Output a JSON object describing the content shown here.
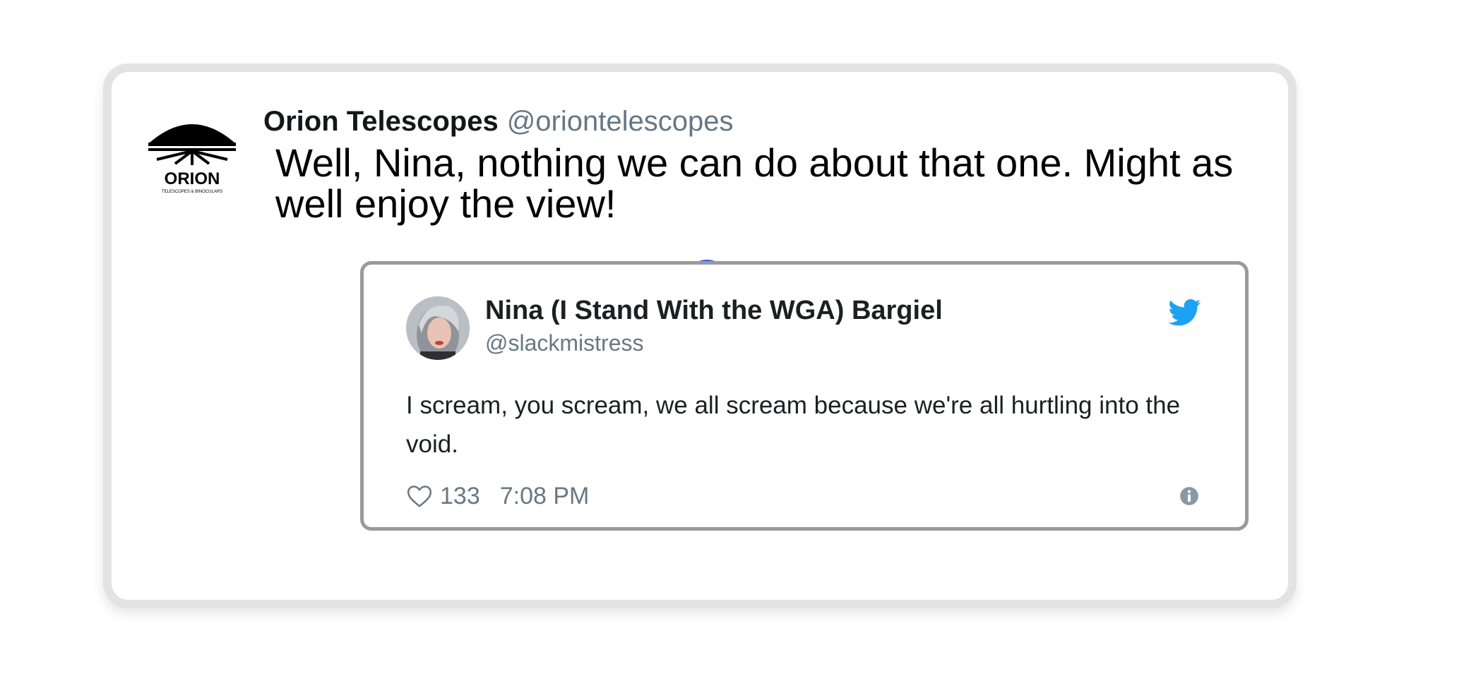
{
  "tweet": {
    "author_name": "Orion Telescopes",
    "author_handle": "@oriontelescopes",
    "text": "Well, Nina, nothing we can do about that one. Might as well enjoy the view!",
    "logo": {
      "icon": "orion-logo-icon",
      "wordmark": "ORION",
      "tagline": "TELESCOPES & BINOCULARS"
    }
  },
  "quoted": {
    "author_name": "Nina (I Stand With the WGA) Bargiel",
    "author_handle": "@slackmistress",
    "text": "I scream, you scream, we all scream because we're all hurtling into the void.",
    "likes": "133",
    "time": "7:08 PM",
    "icons": {
      "brand": "twitter-bird-icon",
      "like": "heart-icon",
      "info": "info-icon"
    }
  },
  "colors": {
    "handle_gray": "#657786",
    "twitter_blue": "#1da1f2",
    "embed_border": "#9a9a9a",
    "card_border": "#e3e3e3"
  }
}
